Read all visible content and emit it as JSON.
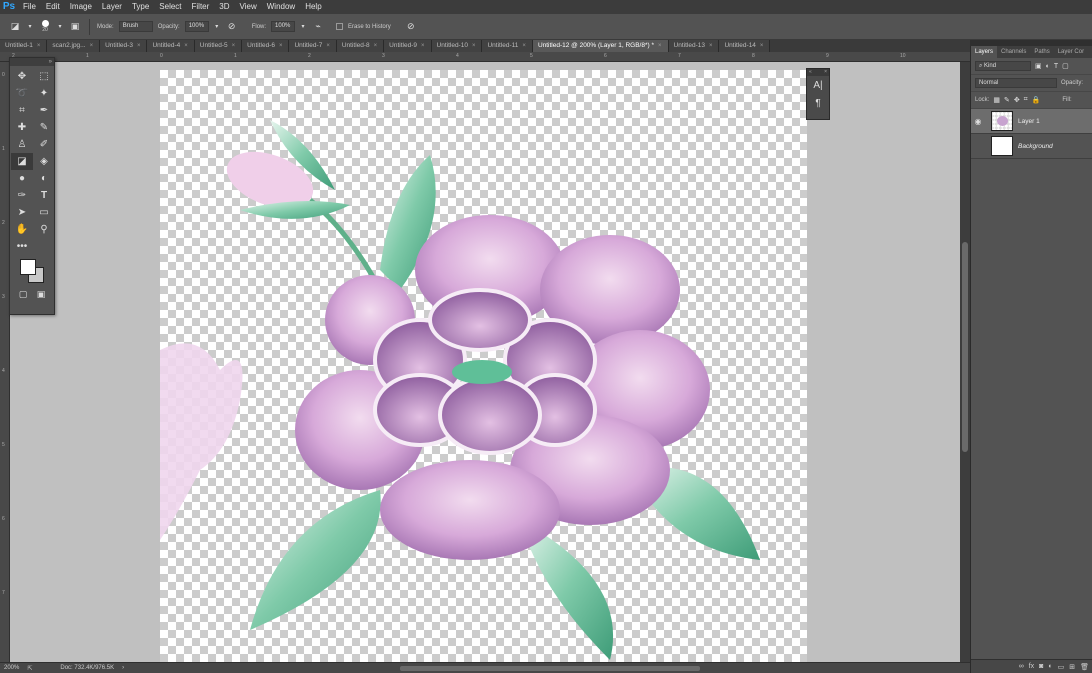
{
  "app": {
    "logo": "Ps"
  },
  "menu": [
    "File",
    "Edit",
    "Image",
    "Layer",
    "Type",
    "Select",
    "Filter",
    "3D",
    "View",
    "Window",
    "Help"
  ],
  "options": {
    "brush_size": "20",
    "mode_label": "Mode:",
    "mode_value": "Brush",
    "opacity_label": "Opacity:",
    "opacity_value": "100%",
    "flow_label": "Flow:",
    "flow_value": "100%",
    "erase_history_label": "Erase to History"
  },
  "tabs": [
    {
      "label": "Untitled-1",
      "active": false
    },
    {
      "label": "scan2.jpg...",
      "active": false
    },
    {
      "label": "Untitled-3",
      "active": false
    },
    {
      "label": "Untitled-4",
      "active": false
    },
    {
      "label": "Untitled-5",
      "active": false
    },
    {
      "label": "Untitled-6",
      "active": false
    },
    {
      "label": "Untitled-7",
      "active": false
    },
    {
      "label": "Untitled-8",
      "active": false
    },
    {
      "label": "Untitled-9",
      "active": false
    },
    {
      "label": "Untitled-10",
      "active": false
    },
    {
      "label": "Untitled-11",
      "active": false
    },
    {
      "label": "Untitled-12 @ 200% (Layer 1, RGB/8*) *",
      "active": true
    },
    {
      "label": "Untitled-13",
      "active": false
    },
    {
      "label": "Untitled-14",
      "active": false
    }
  ],
  "ruler_top_labels": [
    "2",
    "1",
    "0",
    "1",
    "2",
    "3",
    "4",
    "5",
    "6",
    "7",
    "8",
    "9",
    "10",
    "11"
  ],
  "ruler_left_labels": [
    "0",
    "1",
    "2",
    "3",
    "4",
    "5",
    "6",
    "7"
  ],
  "status": {
    "zoom": "200%",
    "doc": "Doc: 732.4K/976.5K"
  },
  "layers_panel": {
    "tabs": [
      "Layers",
      "Channels",
      "Paths",
      "Layer Cor"
    ],
    "filter_label": "Kind",
    "blend_mode": "Normal",
    "opacity_label": "Opacity:",
    "lock_label": "Lock:",
    "fill_label": "Fill:",
    "layers": [
      {
        "name": "Layer 1",
        "visible": true,
        "selected": true
      },
      {
        "name": "Background",
        "visible": false,
        "selected": false
      }
    ]
  },
  "colors": {
    "accent": "#31a8ff",
    "petal_light": "#e6c3e6",
    "petal_dark": "#9a6aa8",
    "leaf": "#5fb895"
  }
}
